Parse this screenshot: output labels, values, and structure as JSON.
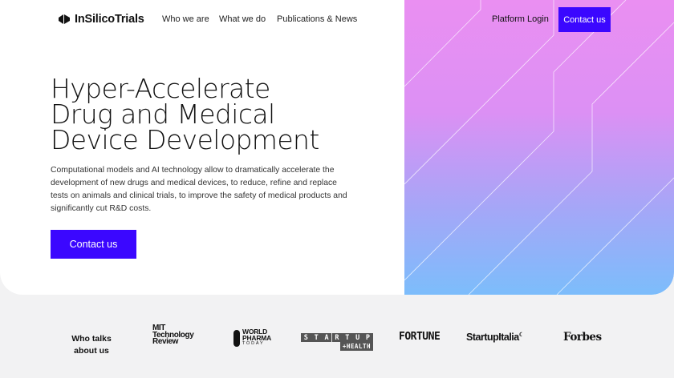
{
  "nav": {
    "logo_text": "InSilicoTrials",
    "links": [
      "Who we are",
      "What we do",
      "Publications & News"
    ],
    "login_label": "Platform Login",
    "contact_label": "Contact us"
  },
  "hero": {
    "title_lines": [
      "Hyper-Accelerate",
      "Drug and Medical",
      "Device Development"
    ],
    "body": "Computational models and AI technology allow to dramatically accelerate the development of new drugs and medical devices, to reduce, refine and replace tests on animals and clinical trials, to improve the safety of medical products and significantly cut R&D costs.",
    "cta_label": "Contact us"
  },
  "press": {
    "heading": "Who talks about us",
    "logos": {
      "mit": [
        "MIT",
        "Technology",
        "Review"
      ],
      "world_pharma": [
        "WORLD",
        "PHARMA",
        "TODAY"
      ],
      "startup_health": [
        "STARTUP",
        "+HEALTH"
      ],
      "fortune": "FORTUNE",
      "startupitalia": "StartupItalia",
      "forbes": "Forbes"
    }
  },
  "colors": {
    "accent": "#3b07ff",
    "gradient_top": "#ea8ff2",
    "gradient_bottom": "#7cbdfb",
    "page_bg": "#f2f2f3"
  }
}
